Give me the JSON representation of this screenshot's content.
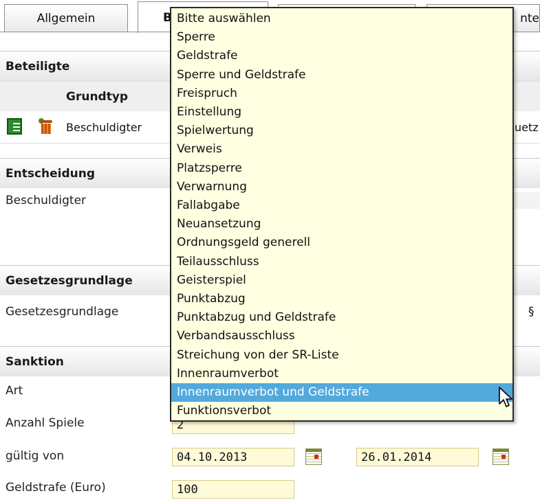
{
  "tabs": [
    {
      "label": "Allgemein"
    },
    {
      "label": "B"
    },
    {
      "label": ""
    },
    {
      "label": "nte"
    }
  ],
  "beteiligte": {
    "title": "Beteiligte",
    "column_header": "Grundtyp",
    "row": {
      "grundtyp": "Beschuldigter",
      "right_fragment": "uetz"
    }
  },
  "entscheidung": {
    "title": "Entscheidung",
    "row_label": "Beschuldigter"
  },
  "gesetz": {
    "title": "Gesetzesgrundlage",
    "row_label": "Gesetzesgrundlage",
    "right_fragment": "§"
  },
  "sanktion": {
    "title": "Sanktion",
    "art_label": "Art",
    "anzahl_label": "Anzahl Spiele",
    "anzahl_value": "2",
    "gueltig_label": "gültig von",
    "gueltig_von": "04.10.2013",
    "gueltig_bis": "26.01.2014",
    "geldstrafe_label": "Geldstrafe (Euro)",
    "geldstrafe_value": "100"
  },
  "icons": {
    "edit": "list-edit-icon",
    "delete": "trash-icon",
    "calendar": "calendar-icon",
    "cursor": "mouse-pointer-icon"
  },
  "colors": {
    "field_bg": "#fffbd8",
    "dropdown_bg": "#ffffe1",
    "selected_bg": "#52a9dc"
  },
  "art_dropdown": {
    "selected_index": 20,
    "options": [
      "Bitte auswählen",
      "Sperre",
      "Geldstrafe",
      "Sperre und Geldstrafe",
      "Freispruch",
      "Einstellung",
      "Spielwertung",
      "Verweis",
      "Platzsperre",
      "Verwarnung",
      "Fallabgabe",
      "Neuansetzung",
      "Ordnungsgeld generell",
      "Teilausschluss",
      "Geisterspiel",
      "Punktabzug",
      "Punktabzug und Geldstrafe",
      "Verbandsausschluss",
      "Streichung von der SR-Liste",
      "Innenraumverbot",
      "Innenraumverbot und Geldstrafe",
      "Funktionsverbot"
    ]
  }
}
